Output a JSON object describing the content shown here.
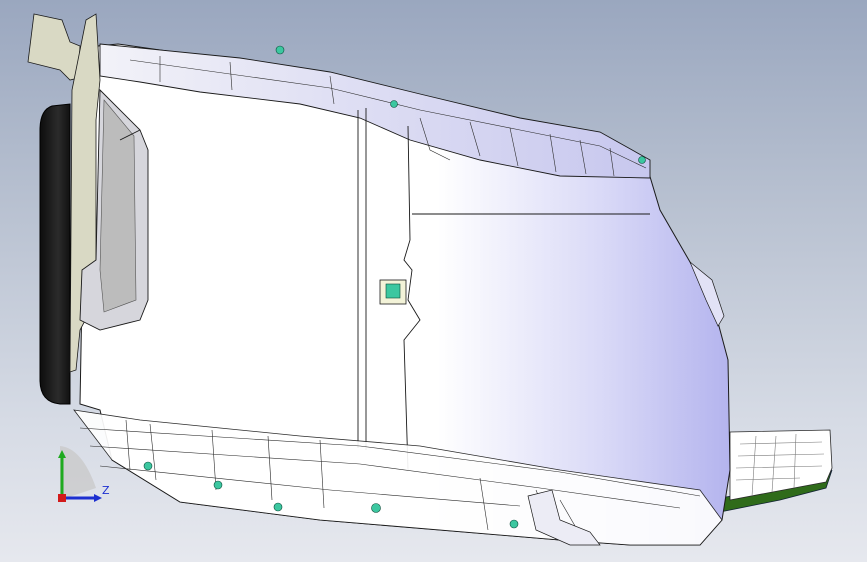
{
  "viewport": {
    "background_top": "#9aa7bf",
    "background_bottom": "#e6e8ee"
  },
  "model": {
    "body_color": "#ffffff",
    "shade_color": "#b9b9f2",
    "trim_color": "#2f6b1a",
    "bracket_color": "#d9d9c4",
    "fastener_color": "#3cc7a0",
    "edge_color": "#1a1a1a"
  },
  "triad": {
    "x_label": "",
    "y_label": "",
    "z_label": "Z",
    "x_color": "#1c2fd0",
    "y_color": "#1faa1f",
    "origin_color": "#d21a1a"
  }
}
